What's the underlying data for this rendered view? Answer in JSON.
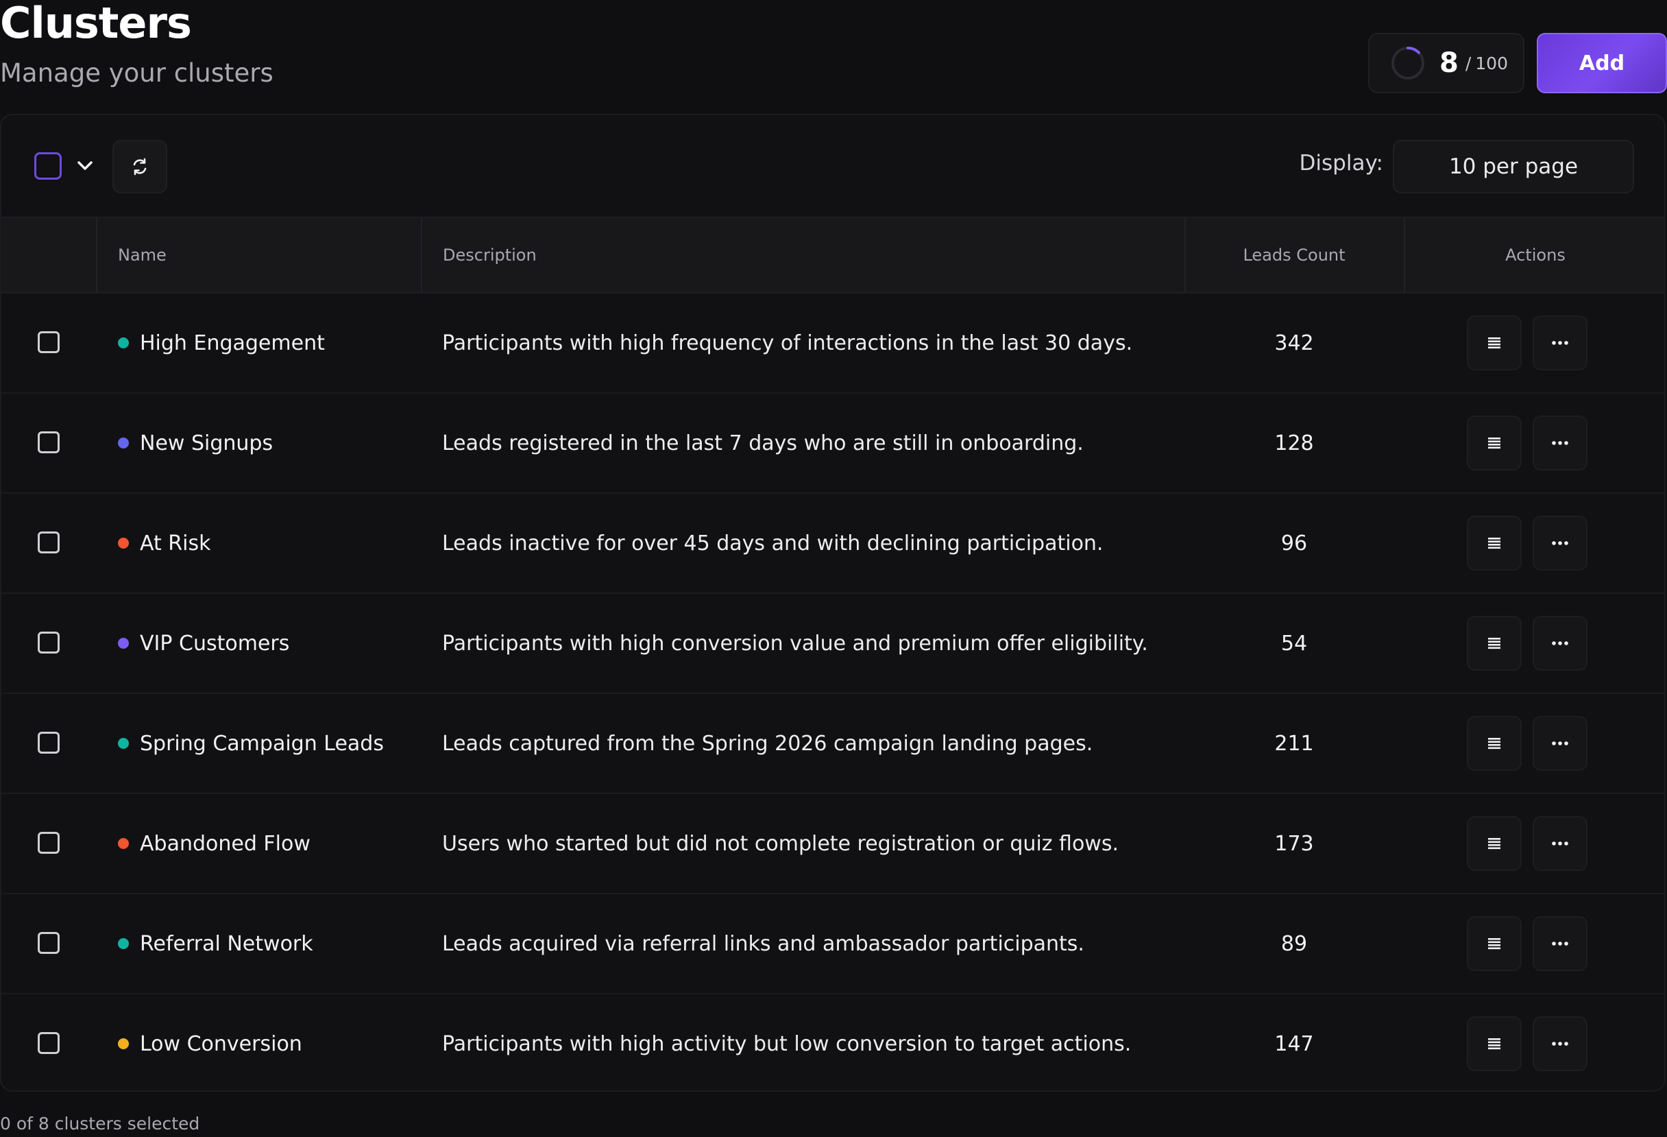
{
  "header": {
    "title": "Clusters",
    "subtitle": "Manage your clusters"
  },
  "quota": {
    "used": "8",
    "separator": "/",
    "total": "100",
    "fraction": 0.08
  },
  "add_label": "Add",
  "toolbar": {
    "display_label": "Display:",
    "per_page": "10 per page"
  },
  "table": {
    "columns": {
      "name": "Name",
      "description": "Description",
      "leads_count": "Leads Count",
      "actions": "Actions"
    },
    "rows": [
      {
        "name": "High Engagement",
        "dot_color": "#10b3a0",
        "description": "Participants with high frequency of interactions in the last 30 days.",
        "count": "342"
      },
      {
        "name": "New Signups",
        "dot_color": "#6366f1",
        "description": "Leads registered in the last 7 days who are still in onboarding.",
        "count": "128"
      },
      {
        "name": "At Risk",
        "dot_color": "#f0552f",
        "description": "Leads inactive for over 45 days and with declining participation.",
        "count": "96"
      },
      {
        "name": "VIP Customers",
        "dot_color": "#7c5cf2",
        "description": "Participants with high conversion value and premium offer eligibility.",
        "count": "54"
      },
      {
        "name": "Spring Campaign Leads",
        "dot_color": "#10b3a0",
        "description": "Leads captured from the Spring 2026 campaign landing pages.",
        "count": "211"
      },
      {
        "name": "Abandoned Flow",
        "dot_color": "#f0552f",
        "description": "Users who started but did not complete registration or quiz flows.",
        "count": "173"
      },
      {
        "name": "Referral Network",
        "dot_color": "#10b3a0",
        "description": "Leads acquired via referral links and ambassador participants.",
        "count": "89"
      },
      {
        "name": "Low Conversion",
        "dot_color": "#f2b01e",
        "description": "Participants with high activity but low conversion to target actions.",
        "count": "147"
      }
    ]
  },
  "footer": {
    "selection_status": "0 of 8 clusters selected"
  },
  "colors": {
    "accent": "#7a4bef",
    "background": "#0f0f11"
  }
}
